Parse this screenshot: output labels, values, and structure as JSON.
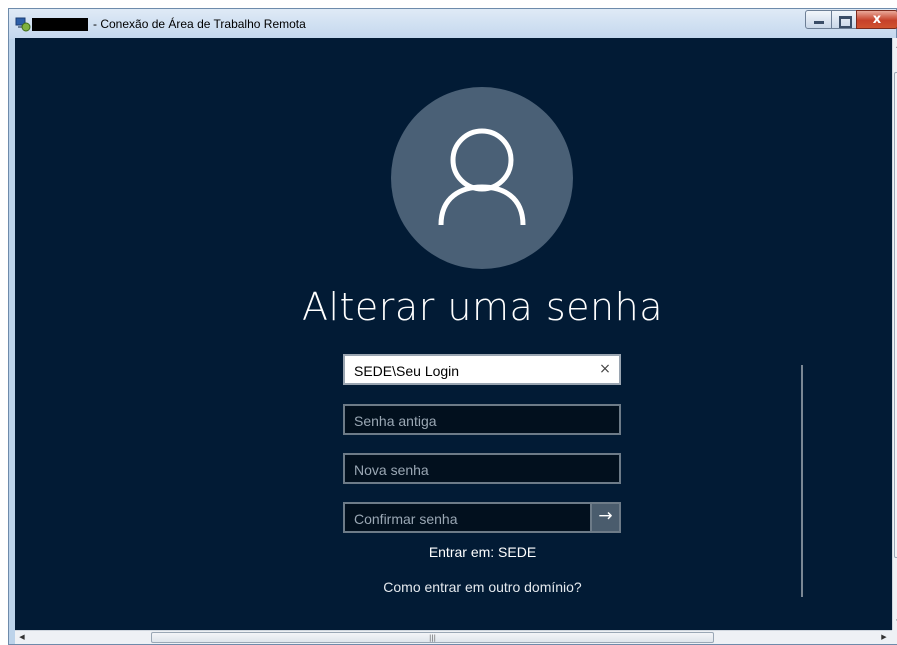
{
  "window": {
    "title": "- Conexão de Área de Trabalho Remota",
    "close_glyph": "x"
  },
  "icons": {
    "app": "remote-desktop-icon",
    "avatar": "user-icon",
    "clear": "close-icon",
    "submit": "arrow-right-icon"
  },
  "login": {
    "heading": "Alterar uma senha",
    "username": {
      "value": "SEDE\\Seu Login",
      "clear_glyph": "×"
    },
    "old_password": {
      "placeholder": "Senha antiga"
    },
    "new_password": {
      "placeholder": "Nova senha"
    },
    "confirm_password": {
      "placeholder": "Confirmar senha",
      "submit_glyph": "→"
    },
    "signin_domain": "Entrar em: SEDE",
    "other_domain_link": "Como entrar em outro domínio?"
  },
  "colors": {
    "background": "#021b35",
    "avatar": "#4a6076",
    "field_border": "#6d7b88"
  }
}
